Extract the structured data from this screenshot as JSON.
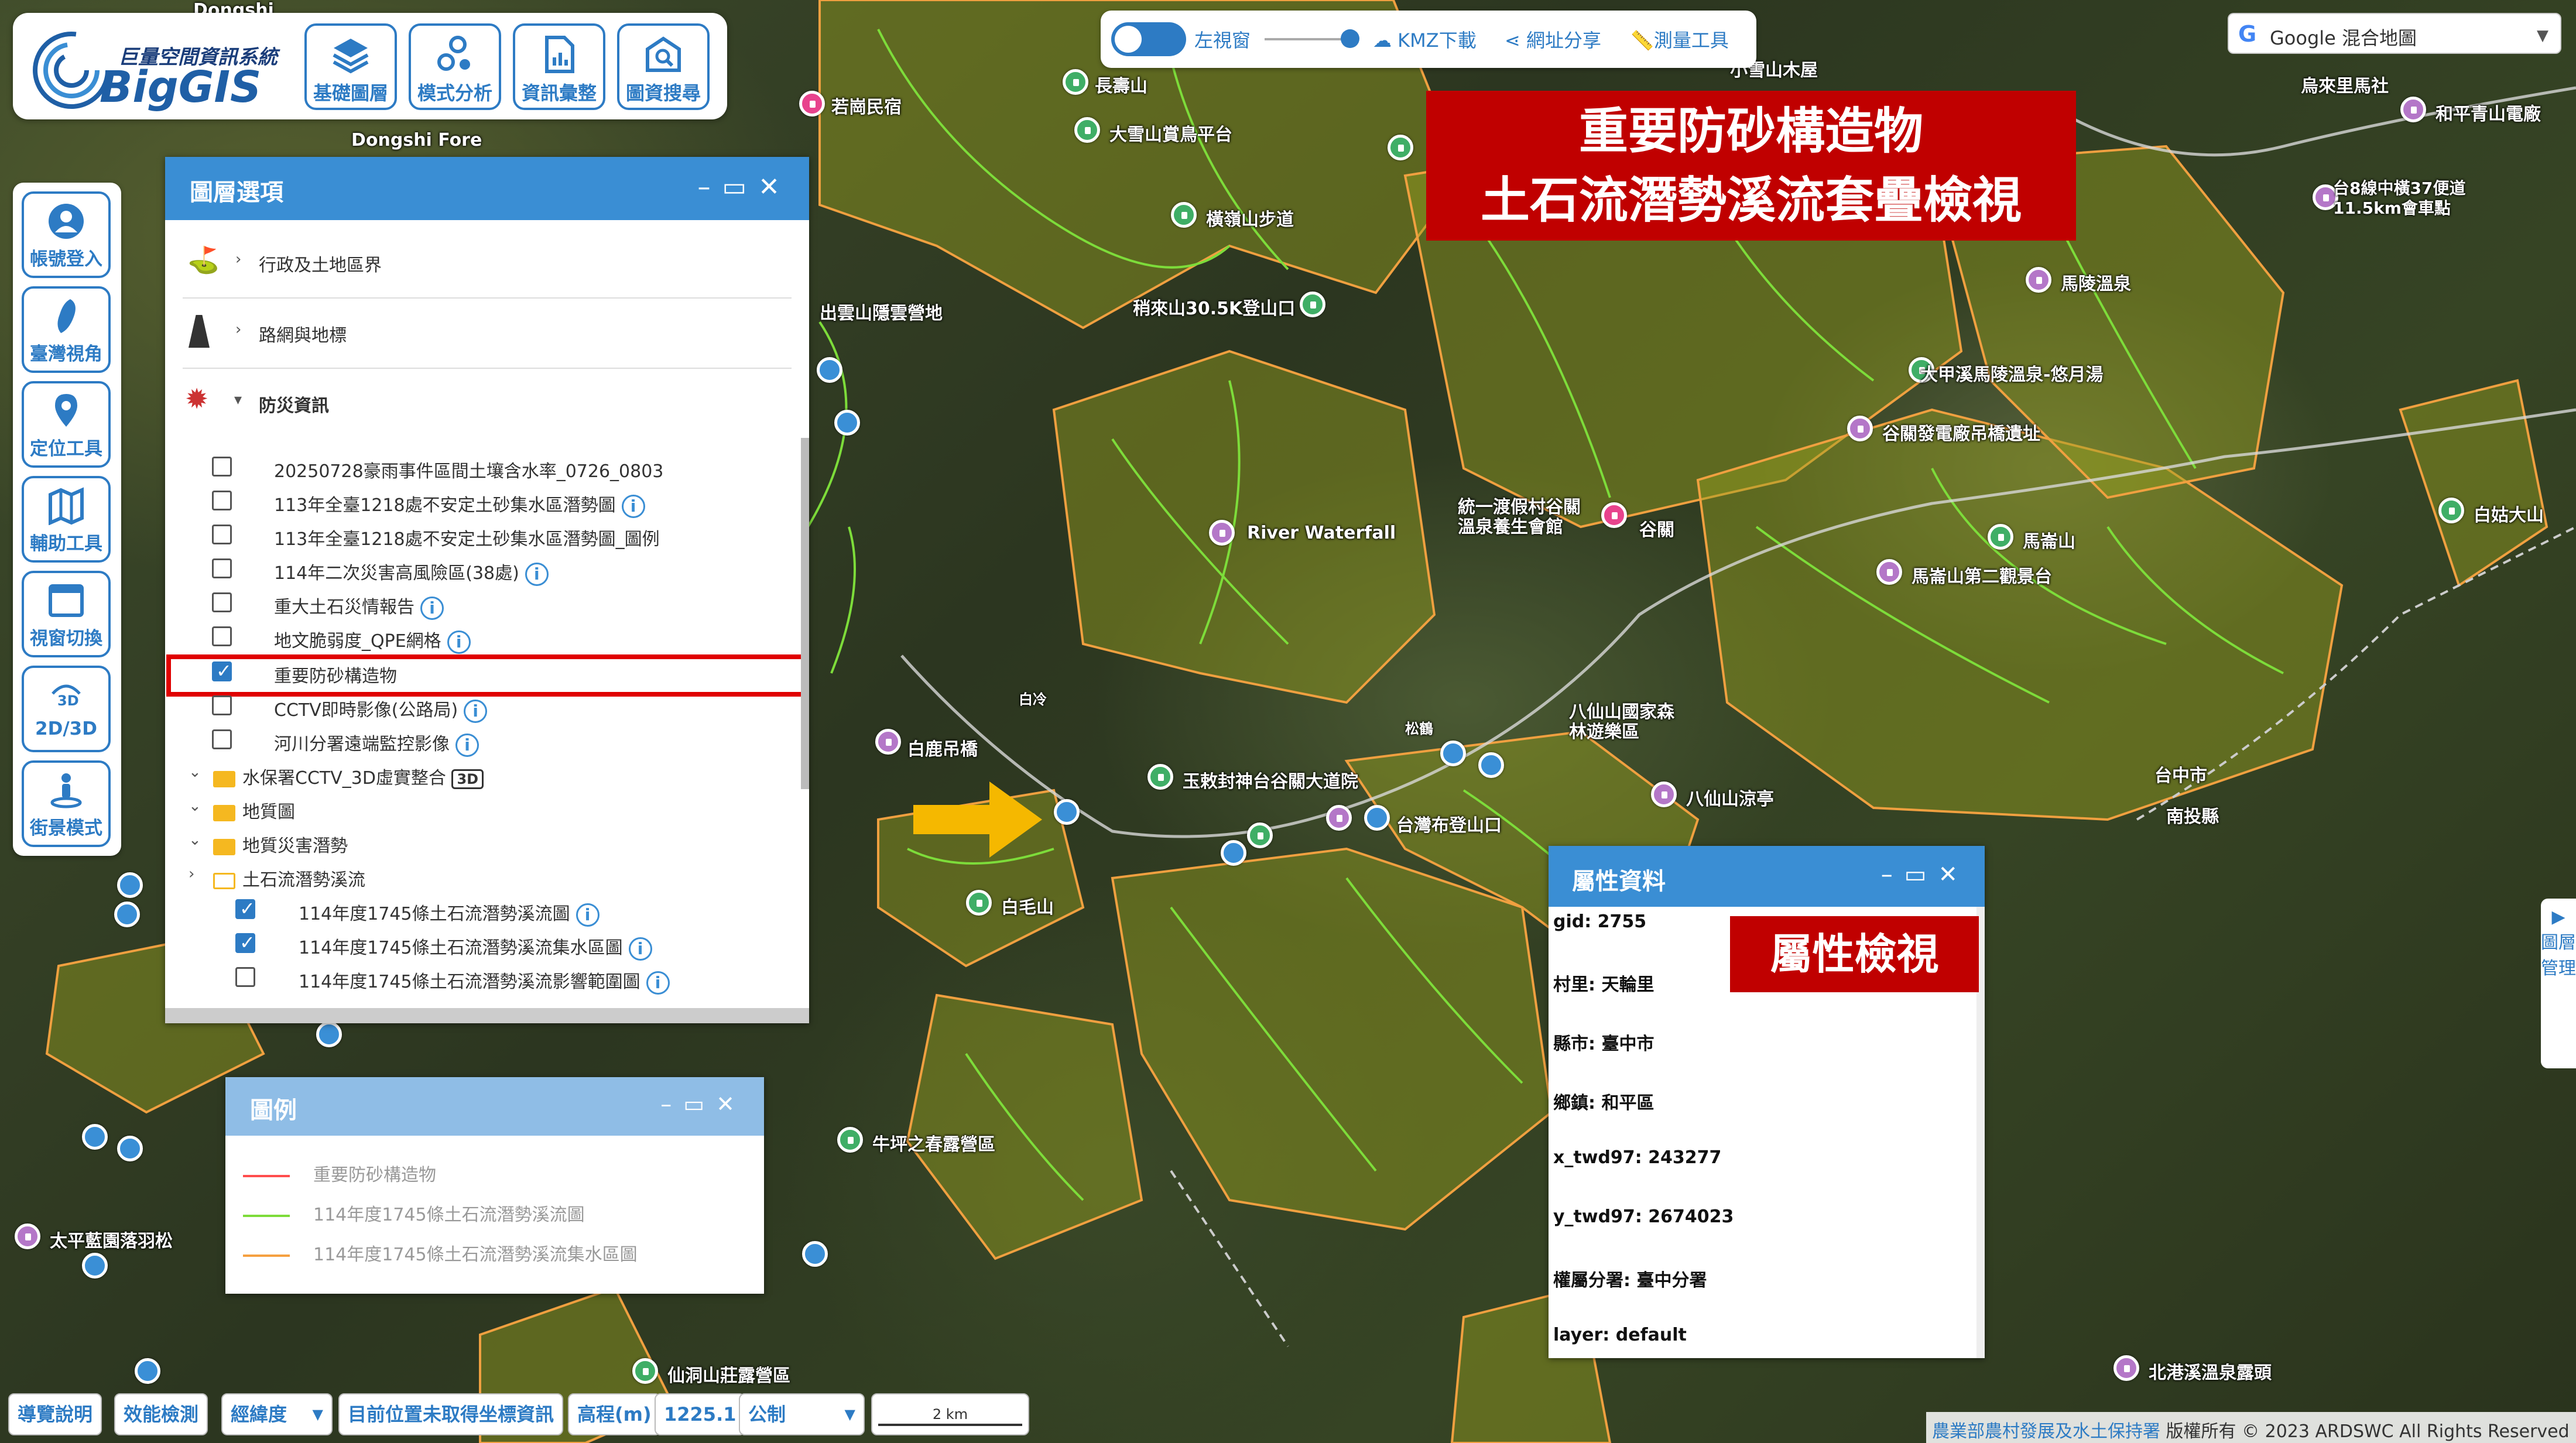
{
  "logo": {
    "cn": "巨量空間資訊系統",
    "en": "BigGIS"
  },
  "toolbar": {
    "items": [
      {
        "label": "基礎圖層",
        "icon": "layers-icon"
      },
      {
        "label": "模式分析",
        "icon": "analysis-icon"
      },
      {
        "label": "資訊彙整",
        "icon": "report-icon"
      },
      {
        "label": "圖資搜尋",
        "icon": "search-map-icon"
      }
    ]
  },
  "top_tools": {
    "left_window": "左視窗",
    "kmz": "KMZ下載",
    "share": "網址分享",
    "measure": "測量工具"
  },
  "basemap": {
    "label": "Google 混合地圖"
  },
  "sidebar": {
    "items": [
      {
        "label": "帳號登入",
        "icon": "user-icon"
      },
      {
        "label": "臺灣視角",
        "icon": "taiwan-icon"
      },
      {
        "label": "定位工具",
        "icon": "location-pin-icon"
      },
      {
        "label": "輔助工具",
        "icon": "map-tool-icon"
      },
      {
        "label": "視窗切換",
        "icon": "window-icon"
      },
      {
        "label": "2D/3D",
        "icon": "3d-icon"
      },
      {
        "label": "街景模式",
        "icon": "street-view-icon"
      }
    ]
  },
  "layer_panel": {
    "title": "圖層選項",
    "categories": [
      {
        "label": "行政及土地區界"
      },
      {
        "label": "路網與地標"
      },
      {
        "label": "防災資訊"
      }
    ],
    "items": [
      {
        "label": "20250728豪雨事件區間土壤含水率_0726_0803",
        "checked": false,
        "info": false
      },
      {
        "label": "113年全臺1218處不安定土砂集水區潛勢圖",
        "checked": false,
        "info": true
      },
      {
        "label": "113年全臺1218處不安定土砂集水區潛勢圖_圖例",
        "checked": false,
        "info": false
      },
      {
        "label": "114年二次災害高風險區(38處)",
        "checked": false,
        "info": true
      },
      {
        "label": "重大土石災情報告",
        "checked": false,
        "info": true
      },
      {
        "label": "地文脆弱度_QPE網格",
        "checked": false,
        "info": true
      },
      {
        "label": "重要防砂構造物",
        "checked": true,
        "info": false
      },
      {
        "label": "CCTV即時影像(公路局)",
        "checked": false,
        "info": true
      },
      {
        "label": "河川分署遠端監控影像",
        "checked": false,
        "info": true
      }
    ],
    "folders": [
      {
        "label": "水保署CCTV_3D虛實整合",
        "badge": "3D"
      },
      {
        "label": "地質圖"
      },
      {
        "label": "地質災害潛勢"
      },
      {
        "label": "土石流潛勢溪流"
      }
    ],
    "sub_items": [
      {
        "label": "114年度1745條土石流潛勢溪流圖",
        "checked": true
      },
      {
        "label": "114年度1745條土石流潛勢溪流集水區圖",
        "checked": true
      },
      {
        "label": "114年度1745條土石流潛勢溪流影響範圍圖",
        "checked": false
      }
    ]
  },
  "legend": {
    "title": "圖例",
    "items": [
      {
        "label": "重要防砂構造物",
        "color": "#ff4d4d"
      },
      {
        "label": "114年度1745條土石流潛勢溪流圖",
        "color": "#7ddc3a"
      },
      {
        "label": "114年度1745條土石流潛勢溪流集水區圖",
        "color": "#f5a040"
      }
    ]
  },
  "attr_panel": {
    "title": "屬性資料",
    "rows": [
      "gid: 2755",
      "村里: 天輪里",
      "縣市: 臺中市",
      "鄉鎮: 和平區",
      "x_twd97: 243277",
      "y_twd97: 2674023",
      "權屬分署: 臺中分署",
      "layer: default"
    ]
  },
  "banners": {
    "main_line1": "重要防砂構造物",
    "main_line2": "土石流潛勢溪流套疊檢視",
    "attr": "屬性檢視"
  },
  "map_labels": [
    {
      "t": "Dongshi"
    },
    {
      "t": "長壽山"
    },
    {
      "t": "若崗民宿"
    },
    {
      "t": "大雪山賞鳥平台"
    },
    {
      "t": "橫嶺山步道"
    },
    {
      "t": "出雲山隱雲營地"
    },
    {
      "t": "稍來山30.5K登山口"
    },
    {
      "t": "Dongshi Fore"
    },
    {
      "t": "River Waterfall"
    },
    {
      "t": "統一渡假村谷關溫泉養生會館"
    },
    {
      "t": "谷關"
    },
    {
      "t": "谷關發電廠吊橋遺址"
    },
    {
      "t": "大甲溪馬陵溫泉-悠月湯"
    },
    {
      "t": "馬陵溫泉"
    },
    {
      "t": "馬崙山"
    },
    {
      "t": "馬崙山第二觀景台"
    },
    {
      "t": "白姑大山"
    },
    {
      "t": "八仙山國家森林遊樂區"
    },
    {
      "t": "八仙山涼亭"
    },
    {
      "t": "白鹿吊橋"
    },
    {
      "t": "白冷"
    },
    {
      "t": "白毛山"
    },
    {
      "t": "玉敕封神台谷關大道院"
    },
    {
      "t": "台灣布登山口"
    },
    {
      "t": "松鶴"
    },
    {
      "t": "牛坪之春露營區"
    },
    {
      "t": "太平藍園落羽松"
    },
    {
      "t": "仙洞山莊露營區"
    },
    {
      "t": "北港溪溫泉露頭"
    },
    {
      "t": "台中市"
    },
    {
      "t": "南投縣"
    },
    {
      "t": "和平青山電廠"
    },
    {
      "t": "烏來里馬社"
    },
    {
      "t": "台8線中橫37便道11.5km會車點"
    },
    {
      "t": "小雪山木屋"
    }
  ],
  "bottom_bar": {
    "guide": "導覽說明",
    "perf": "效能檢測",
    "coord_type": "經緯度",
    "coord_text": "目前位置未取得坐標資訊",
    "elev_label": "高程(m)",
    "elev_value": "1225.1",
    "unit": "公制",
    "scale": "2 km"
  },
  "copyright": {
    "org": "農業部農村發展及水土保持署",
    "text": "版權所有 © 2023 ARDSWC All Rights Reserved"
  },
  "right_tab": {
    "label": "▶ 圖層管理"
  }
}
